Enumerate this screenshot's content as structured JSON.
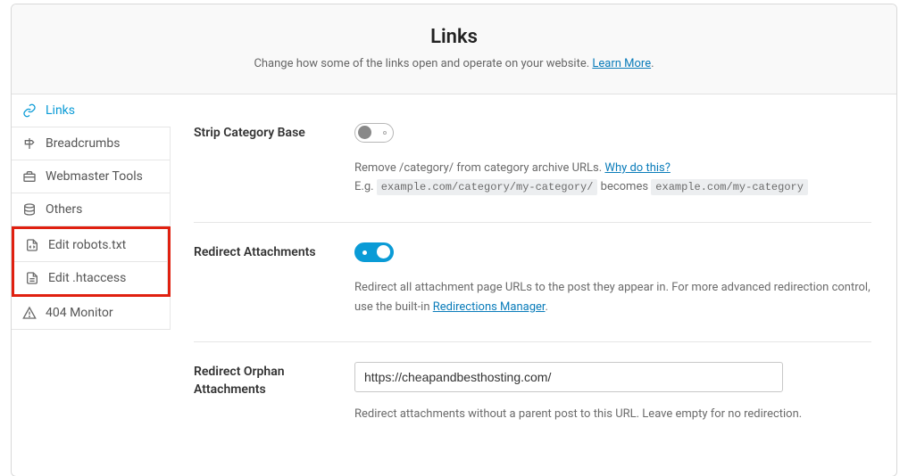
{
  "header": {
    "title": "Links",
    "subtitle_pre": "Change how some of the links open and operate on your website. ",
    "learn_more": "Learn More",
    "subtitle_post": "."
  },
  "sidebar": {
    "items": [
      {
        "label": "Links"
      },
      {
        "label": "Breadcrumbs"
      },
      {
        "label": "Webmaster Tools"
      },
      {
        "label": "Others"
      },
      {
        "label": "Edit robots.txt"
      },
      {
        "label": "Edit .htaccess"
      },
      {
        "label": "404 Monitor"
      }
    ]
  },
  "settings": {
    "strip_category": {
      "label": "Strip Category Base",
      "desc_pre": "Remove /category/ from category archive URLs. ",
      "why_link": "Why do this?",
      "desc_eg": "E.g. ",
      "code_before": "example.com/category/my-category/",
      "desc_becomes": " becomes ",
      "code_after": "example.com/my-category"
    },
    "redirect_attachments": {
      "label": "Redirect Attachments",
      "desc_pre": "Redirect all attachment page URLs to the post they appear in. For more advanced redirection control, use the built-in  ",
      "link": "Redirections Manager",
      "desc_post": "."
    },
    "redirect_orphan": {
      "label": "Redirect Orphan Attachments",
      "value": "https://cheapandbesthosting.com/",
      "desc": "Redirect attachments without a parent post to this URL. Leave empty for no redirection."
    }
  }
}
